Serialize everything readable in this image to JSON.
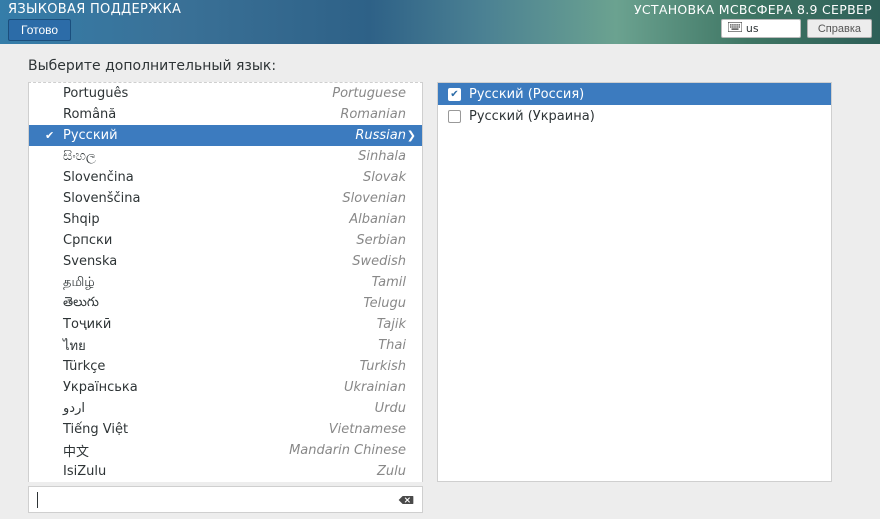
{
  "header": {
    "title": "ЯЗЫКОВАЯ ПОДДЕРЖКА",
    "done_label": "Готово",
    "product": "УСТАНОВКА МСВСФЕРА 8.9 СЕРВЕР",
    "keyboard_indicator": "us",
    "help_label": "Справка"
  },
  "main": {
    "instruction": "Выберите дополнительный язык:",
    "search_value": "",
    "search_placeholder": ""
  },
  "languages": [
    {
      "native": "Português",
      "english": "Portuguese"
    },
    {
      "native": "Română",
      "english": "Romanian"
    },
    {
      "native": "Русский",
      "english": "Russian",
      "selected": true
    },
    {
      "native": "සිංහල",
      "english": "Sinhala"
    },
    {
      "native": "Slovenčina",
      "english": "Slovak"
    },
    {
      "native": "Slovenščina",
      "english": "Slovenian"
    },
    {
      "native": "Shqip",
      "english": "Albanian"
    },
    {
      "native": "Српски",
      "english": "Serbian"
    },
    {
      "native": "Svenska",
      "english": "Swedish"
    },
    {
      "native": "தமிழ்",
      "english": "Tamil"
    },
    {
      "native": "తెలుగు",
      "english": "Telugu"
    },
    {
      "native": "Тоҷикӣ",
      "english": "Tajik"
    },
    {
      "native": "ไทย",
      "english": "Thai"
    },
    {
      "native": "Türkçe",
      "english": "Turkish"
    },
    {
      "native": "Українська",
      "english": "Ukrainian"
    },
    {
      "native": "اردو",
      "english": "Urdu"
    },
    {
      "native": "Tiếng Việt",
      "english": "Vietnamese"
    },
    {
      "native": "中文",
      "english": "Mandarin Chinese"
    },
    {
      "native": "IsiZulu",
      "english": "Zulu"
    }
  ],
  "locales": [
    {
      "label": "Русский (Россия)",
      "checked": true,
      "selected": true
    },
    {
      "label": "Русский (Украина)",
      "checked": false,
      "selected": false
    }
  ],
  "colors": {
    "accent": "#3c7bbf"
  }
}
